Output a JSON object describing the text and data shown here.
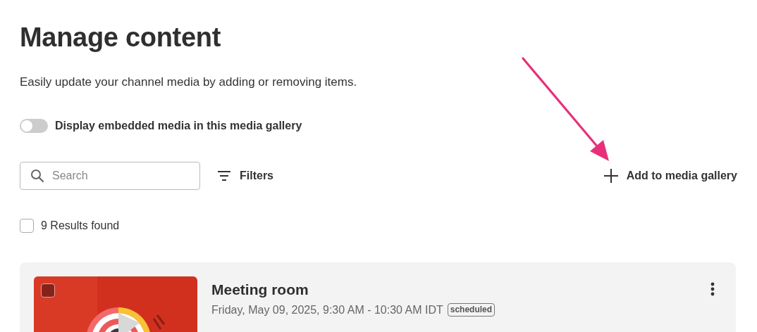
{
  "title": "Manage content",
  "description": "Easily update your channel media by adding or removing items.",
  "embed_toggle": {
    "label": "Display embedded media in this media gallery",
    "on": false
  },
  "search": {
    "placeholder": "Search"
  },
  "filters": {
    "label": "Filters"
  },
  "add_button": {
    "label": "Add to media gallery"
  },
  "results": {
    "label": "9 Results found",
    "checked": false
  },
  "items": [
    {
      "title": "Meeting room",
      "date": "Friday, May 09, 2025, 9:30 AM - 10:30 AM IDT",
      "status": "scheduled",
      "checked": false
    }
  ]
}
